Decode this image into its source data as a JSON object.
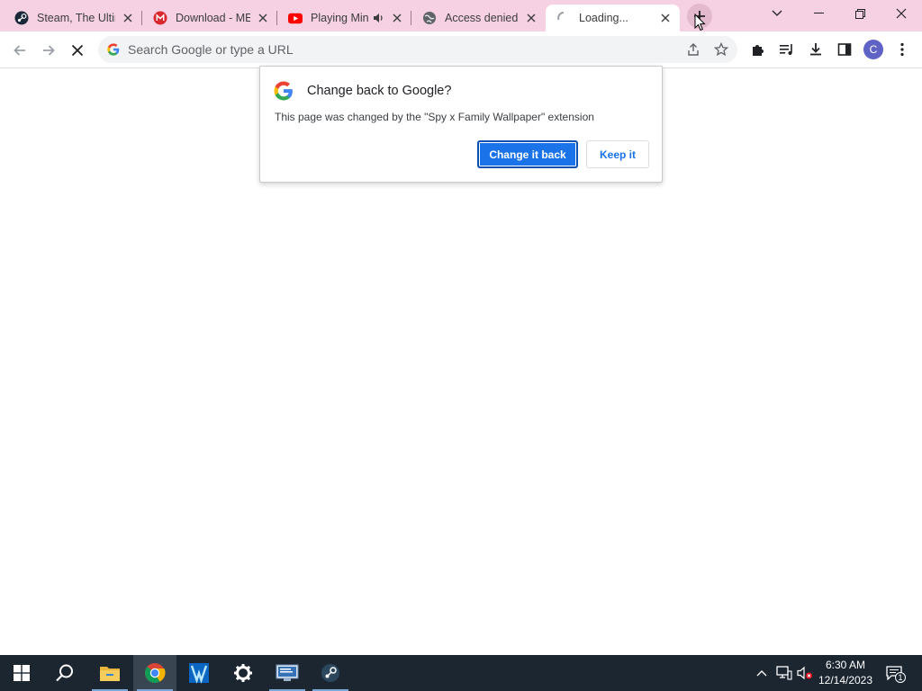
{
  "tabs": [
    {
      "title": "Steam, The Ultim",
      "favicon": "steam-icon",
      "active": false
    },
    {
      "title": "Download - MEG",
      "favicon": "mega-icon",
      "active": false
    },
    {
      "title": "Playing Min",
      "favicon": "youtube-icon",
      "active": false,
      "audio": true
    },
    {
      "title": "Access denied |",
      "favicon": "globe-icon",
      "active": false
    },
    {
      "title": "Loading...",
      "favicon": "spinner-icon",
      "active": true
    }
  ],
  "toolbar": {
    "omnibox_placeholder": "Search Google or type a URL",
    "profile_initial": "C"
  },
  "popup": {
    "title": "Change back to Google?",
    "message": "This page was changed by the \"Spy x Family Wallpaper\" extension",
    "primary_button": "Change it back",
    "secondary_button": "Keep it"
  },
  "taskbar": {
    "apps": [
      "start-icon",
      "search-icon",
      "file-explorer-icon",
      "chrome-icon",
      "app-icon",
      "settings-icon",
      "network-app-icon",
      "steam-icon"
    ],
    "clock_time": "6:30 AM",
    "clock_date": "12/14/2023",
    "notification_count": "1"
  },
  "colors": {
    "tabstrip_bg": "#f5d1e3",
    "accent_blue": "#1a73e8",
    "taskbar_bg": "#1b2631"
  }
}
